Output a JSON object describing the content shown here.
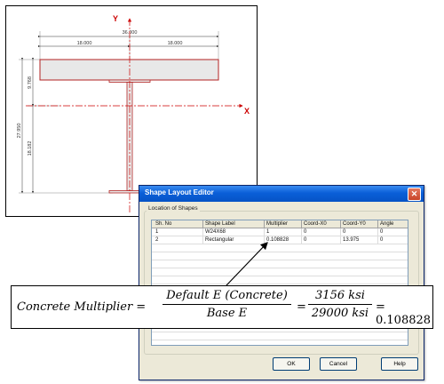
{
  "drawing": {
    "overall_width": "36.000",
    "half_width_left": "18.000",
    "half_width_right": "18.000",
    "slab_depth": "9.768",
    "total_depth": "27.950",
    "steel_depth": "18.182",
    "axis_x_label": "X",
    "axis_y_label": "Y"
  },
  "dialog": {
    "title": "Shape Layout Editor",
    "close_glyph": "✕",
    "group_label": "Location of Shapes",
    "columns": [
      "Sh. No",
      "Shape Label",
      "Multiplier",
      "Coord-X0",
      "Coord-Y0",
      "Angle"
    ],
    "rows": [
      {
        "no": "1",
        "label": "W24X68",
        "multiplier": "1",
        "x0": "0",
        "y0": "0",
        "angle": "0"
      },
      {
        "no": "2",
        "label": "Rectangular",
        "multiplier": "0.108828",
        "x0": "0",
        "y0": "13.975",
        "angle": "0"
      }
    ],
    "buttons": {
      "ok": "OK",
      "cancel": "Cancel",
      "help": "Help"
    }
  },
  "formula": {
    "lhs": "Concrete Multiplier =",
    "frac1_num": "Default E (Concrete)",
    "frac1_den": "Base E",
    "eq2": "=",
    "frac2_num": "3156 ksi",
    "frac2_den": "29000 ksi",
    "result": "= 0.108828"
  },
  "colors": {
    "section": "#b22222",
    "axis": "#cc0000",
    "titlebar": "#0a5fd8",
    "dialog_bg": "#ece9d8"
  }
}
